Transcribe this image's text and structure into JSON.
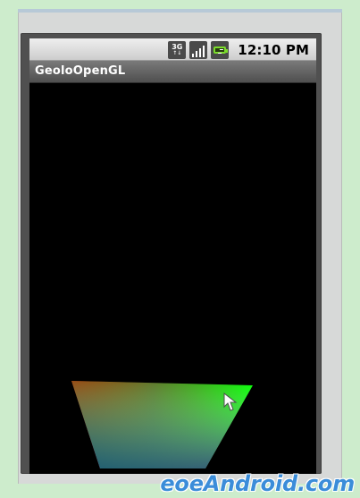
{
  "status_bar": {
    "network_label": "3G",
    "network_sub_label": "↑↓",
    "time": "12:10 PM",
    "icons": [
      "3g-icon",
      "signal-icon",
      "battery-charging-icon"
    ]
  },
  "app": {
    "title": "GeoloOpenGL"
  },
  "watermark": {
    "text": "eoeAndroid.com"
  },
  "colors": {
    "background": "#cdeccc",
    "screen": "#000000",
    "status_bar": "#dcdcdc",
    "title_bar": "#5f5f5f",
    "accent_red": "#ff0000",
    "accent_green": "#00ff00",
    "accent_purple": "#7d14a0",
    "accent_teal": "#16805a"
  }
}
